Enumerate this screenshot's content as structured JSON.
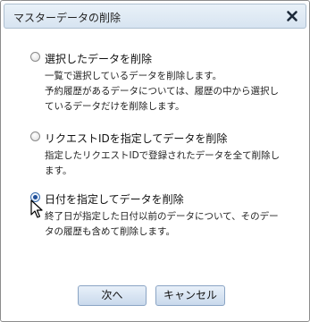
{
  "dialog": {
    "title": "マスターデータの削除",
    "close_icon": "close-icon"
  },
  "options": [
    {
      "label": "選択したデータを削除",
      "checked": false,
      "description": [
        "一覧で選択しているデータを削除します。",
        "予約履歴があるデータについては、履歴の中から選択し",
        "ているデータだけを削除します。"
      ]
    },
    {
      "label": "リクエストIDを指定してデータを削除",
      "checked": false,
      "description": [
        "指定したリクエストIDで登録されたデータを全て削除し",
        "ます。"
      ]
    },
    {
      "label": "日付を指定してデータを削除",
      "checked": true,
      "description": [
        "終了日が指定した日付以前のデータについて、そのデー",
        "タの履歴も含めて削除します。"
      ]
    }
  ],
  "buttons": {
    "next_label": "次へ",
    "cancel_label": "キャンセル"
  }
}
